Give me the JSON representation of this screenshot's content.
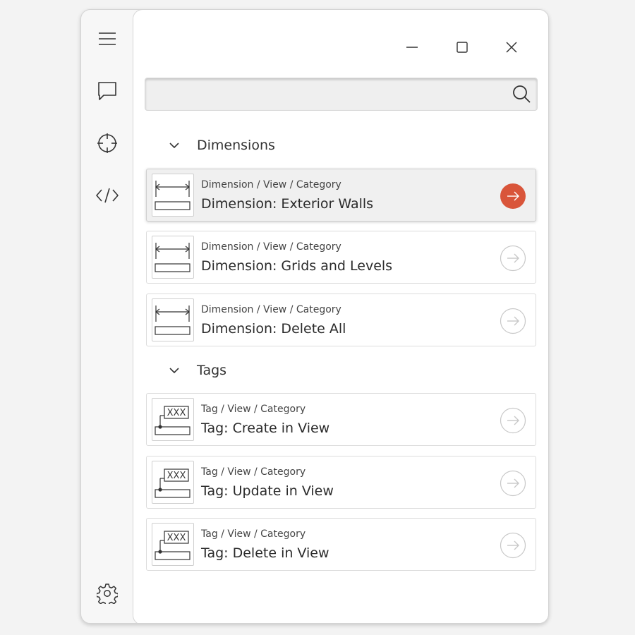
{
  "rail": {
    "items": [
      {
        "icon": "hamburger-menu-icon"
      },
      {
        "icon": "chat-icon"
      },
      {
        "icon": "crosshair-icon"
      },
      {
        "icon": "code-icon"
      }
    ],
    "settings_icon": "gear-icon"
  },
  "window_controls": [
    "minimize-icon",
    "maximize-icon",
    "close-icon"
  ],
  "search": {
    "value": "",
    "placeholder": "",
    "icon": "search-icon"
  },
  "groups": [
    {
      "title": "Dimensions",
      "items": [
        {
          "crumb": "Dimension / View / Category",
          "title": "Dimension: Exterior Walls",
          "selected": true
        },
        {
          "crumb": "Dimension / View / Category",
          "title": "Dimension: Grids and Levels",
          "selected": false
        },
        {
          "crumb": "Dimension / View / Category",
          "title": "Dimension: Delete All",
          "selected": false
        }
      ]
    },
    {
      "title": "Tags",
      "items": [
        {
          "crumb": "Tag / View / Category",
          "title": "Tag: Create in View",
          "selected": false
        },
        {
          "crumb": "Tag / View / Category",
          "title": "Tag: Update in View",
          "selected": false
        },
        {
          "crumb": "Tag / View / Category",
          "title": "Tag: Delete in View",
          "selected": false
        }
      ]
    }
  ],
  "tag_thumb_text": "XXX",
  "colors": {
    "accent": "#d9553a",
    "icon": "#333333",
    "arrow_idle": "#c8c8c8"
  }
}
